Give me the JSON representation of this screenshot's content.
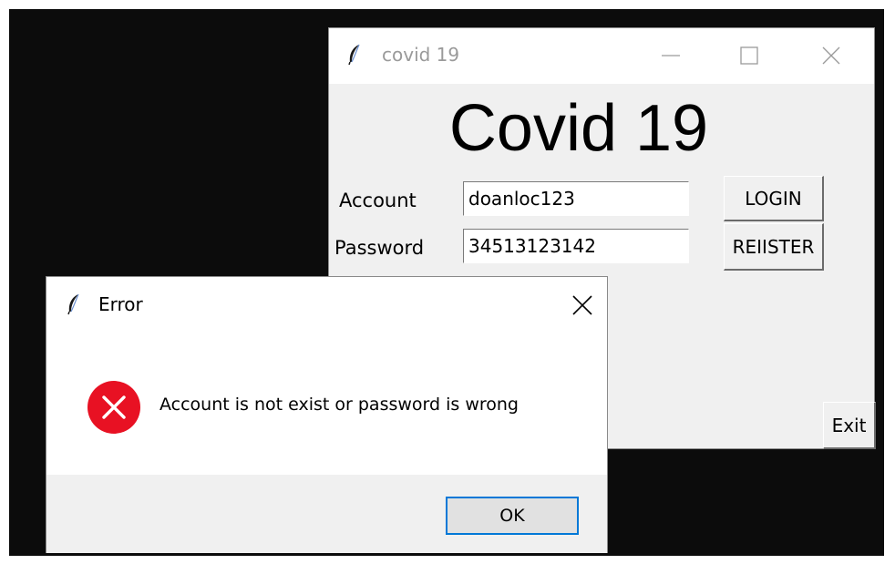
{
  "main_window": {
    "title": "covid 19",
    "heading": "Covid 19",
    "account_label": "Account",
    "account_value": "doanloc123",
    "password_label": "Password",
    "password_value": "34513123142",
    "login_label": "LOGIN",
    "register_label": "REIISTER",
    "exit_label": "Exit",
    "icons": [
      "feather-icon",
      "minimize-icon",
      "maximize-icon",
      "close-icon"
    ]
  },
  "error_dialog": {
    "title": "Error",
    "message": "Account is not exist or password is wrong",
    "ok_label": "OK",
    "icons": [
      "feather-icon",
      "close-icon",
      "error-icon"
    ],
    "error_icon_color": "#e81123"
  },
  "colors": {
    "desktop": "#0c0c0c",
    "window_bg": "#f0f0f0",
    "focus_border": "#0078d7"
  }
}
